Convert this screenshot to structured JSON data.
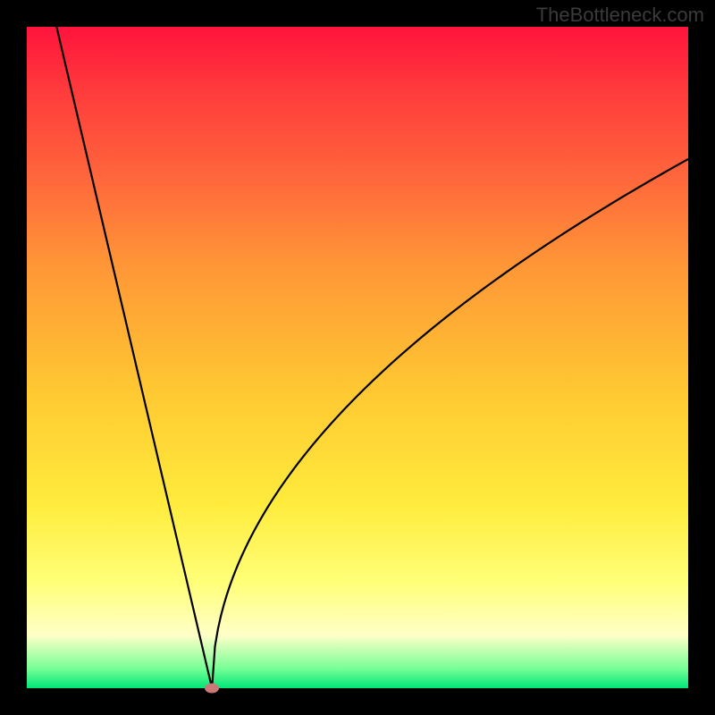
{
  "watermark": "TheBottleneck.com",
  "chart_data": {
    "type": "line",
    "title": "",
    "xlabel": "",
    "ylabel": "",
    "xlim": [
      0,
      100
    ],
    "ylim": [
      0,
      100
    ],
    "grid": false,
    "gradient": {
      "top_color": "#ff143c",
      "bottom_color": "#00e678",
      "meaning": "high value = red (bad), low value = green (good)"
    },
    "curve": {
      "description": "Bottleneck curve reaching 0 at the optimum and rising on both sides; left branch near-linear, right branch concave (square-root-like).",
      "minimum_x": 28,
      "minimum_y": 0,
      "left_branch": {
        "x_start": 4.5,
        "y_start": 100,
        "x_end": 28,
        "y_end": 0,
        "shape": "approximately linear"
      },
      "right_branch": {
        "x_start": 28,
        "y_start": 0,
        "x_end": 100,
        "y_end": 80,
        "shape": "concave, steep near minimum then flattening"
      },
      "series": [
        {
          "x": 4.5,
          "y": 100
        },
        {
          "x": 10,
          "y": 76
        },
        {
          "x": 16,
          "y": 51
        },
        {
          "x": 22,
          "y": 26
        },
        {
          "x": 28,
          "y": 0
        },
        {
          "x": 30,
          "y": 14
        },
        {
          "x": 34,
          "y": 24
        },
        {
          "x": 40,
          "y": 34
        },
        {
          "x": 48,
          "y": 44
        },
        {
          "x": 58,
          "y": 54
        },
        {
          "x": 70,
          "y": 63
        },
        {
          "x": 84,
          "y": 72
        },
        {
          "x": 100,
          "y": 80
        }
      ]
    },
    "marker": {
      "x": 28,
      "y": 0,
      "color": "#cd7878",
      "shape": "ellipse"
    }
  }
}
